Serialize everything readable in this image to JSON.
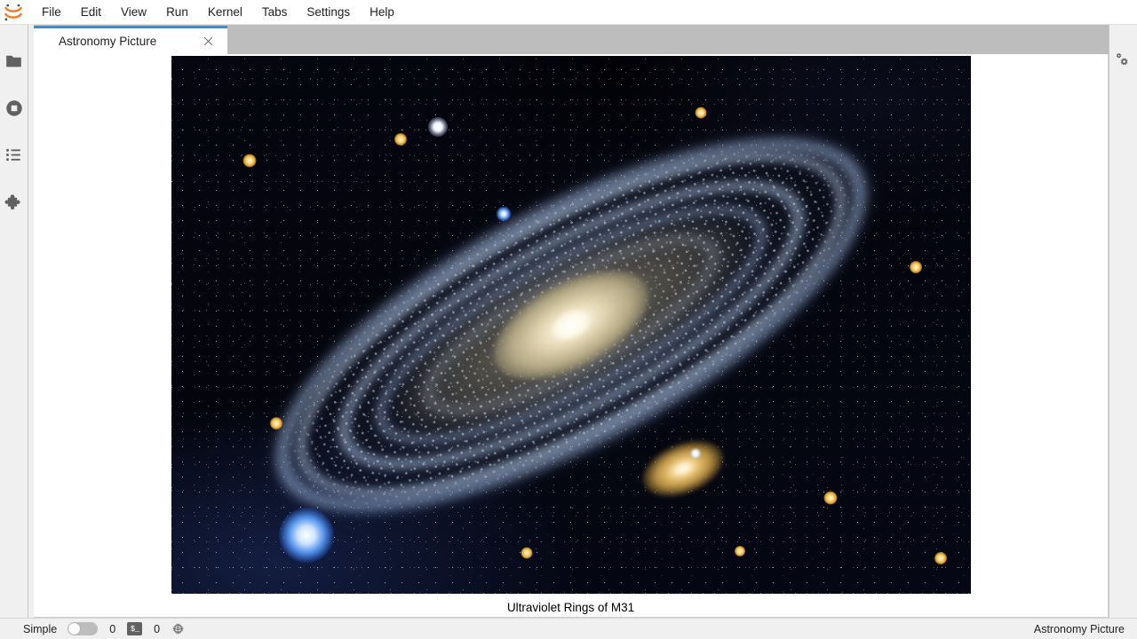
{
  "app": {
    "logo_name": "jupyterlab-logo",
    "accent_color": "#2196f3"
  },
  "menubar": {
    "items": [
      {
        "label": "File"
      },
      {
        "label": "Edit"
      },
      {
        "label": "View"
      },
      {
        "label": "Run"
      },
      {
        "label": "Kernel"
      },
      {
        "label": "Tabs"
      },
      {
        "label": "Settings"
      },
      {
        "label": "Help"
      }
    ]
  },
  "sidebar_left": {
    "items": [
      {
        "icon": "folder-icon",
        "name": "file-browser"
      },
      {
        "icon": "stop-circle-icon",
        "name": "running-terminals-and-kernels"
      },
      {
        "icon": "list-icon",
        "name": "table-of-contents"
      },
      {
        "icon": "puzzle-icon",
        "name": "extension-manager"
      }
    ]
  },
  "sidebar_right": {
    "items": [
      {
        "icon": "gears-icon",
        "name": "property-inspector"
      }
    ]
  },
  "tabbar": {
    "tabs": [
      {
        "label": "Astronomy Picture",
        "active": true,
        "close_icon": "close-icon"
      }
    ]
  },
  "document": {
    "title": "Astronomy Picture",
    "caption": "Ultraviolet Rings of M31",
    "image": {
      "alt": "Ultraviolet image of the Andromeda Galaxy M31 showing blue-white star-forming rings around a warm yellow core, with companion galaxy and a starfield",
      "background_color": "#03040c",
      "core_color": "#fffdf2",
      "ring_color": "#a8c4ee",
      "companion_color": "#e8c071"
    }
  },
  "statusbar": {
    "simple_label": "Simple",
    "simple_enabled": false,
    "kernel_count": "0",
    "terminal_icon": "terminal-icon",
    "terminal_glyph": "$_",
    "terminal_count": "0",
    "kernel_icon": "kernel-cpu-icon",
    "active_document": "Astronomy Picture"
  }
}
